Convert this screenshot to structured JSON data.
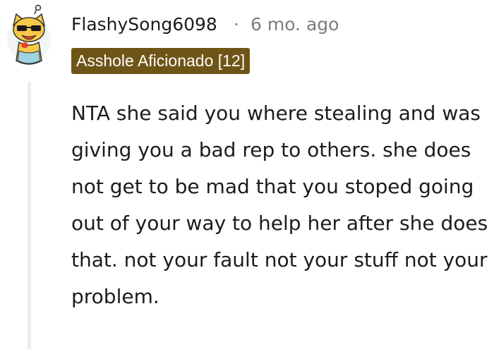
{
  "comment": {
    "username": "FlashySong6098",
    "separator": "·",
    "timestamp": "6 mo. ago",
    "flair": "Asshole Aficionado [12]",
    "avatar_icon": "snoo-avatar-icon",
    "body": "NTA she said you where stealing and was giving you a bad rep to others. she does not get to be mad that you stoped going out of your way to help her after she does that. not your fault not your stuff not your problem."
  },
  "colors": {
    "flair_background": "#6e5517",
    "meta_text": "#7c7c7c",
    "body_text": "#1c1c1c",
    "thread_line": "#ededed"
  }
}
